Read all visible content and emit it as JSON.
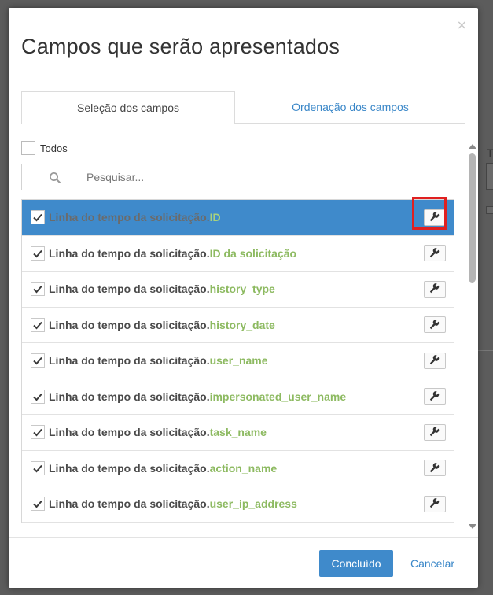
{
  "modal": {
    "title": "Campos que serão apresentados",
    "close_glyph": "×"
  },
  "tabs": [
    {
      "label": "Seleção dos campos",
      "active": true
    },
    {
      "label": "Ordenação dos campos",
      "active": false
    }
  ],
  "select_all": {
    "label": "Todos",
    "checked": false
  },
  "search": {
    "placeholder": "Pesquisar...",
    "value": "",
    "icon": "search-icon"
  },
  "fields": [
    {
      "prefix": "Linha do tempo da solicitação.",
      "name": "ID",
      "checked": true,
      "selected": true
    },
    {
      "prefix": "Linha do tempo da solicitação.",
      "name": "ID da solicitação",
      "checked": true,
      "selected": false
    },
    {
      "prefix": "Linha do tempo da solicitação.",
      "name": "history_type",
      "checked": true,
      "selected": false
    },
    {
      "prefix": "Linha do tempo da solicitação.",
      "name": "history_date",
      "checked": true,
      "selected": false
    },
    {
      "prefix": "Linha do tempo da solicitação.",
      "name": "user_name",
      "checked": true,
      "selected": false
    },
    {
      "prefix": "Linha do tempo da solicitação.",
      "name": "impersonated_user_name",
      "checked": true,
      "selected": false
    },
    {
      "prefix": "Linha do tempo da solicitação.",
      "name": "task_name",
      "checked": true,
      "selected": false
    },
    {
      "prefix": "Linha do tempo da solicitação.",
      "name": "action_name",
      "checked": true,
      "selected": false
    },
    {
      "prefix": "Linha do tempo da solicitação.",
      "name": "user_ip_address",
      "checked": true,
      "selected": false
    }
  ],
  "footer": {
    "confirm_label": "Concluído",
    "cancel_label": "Cancelar"
  },
  "background": {
    "glyph": "T"
  },
  "colors": {
    "accent": "#3f8acb",
    "field_name": "#8dba61",
    "highlight": "#e02020"
  }
}
